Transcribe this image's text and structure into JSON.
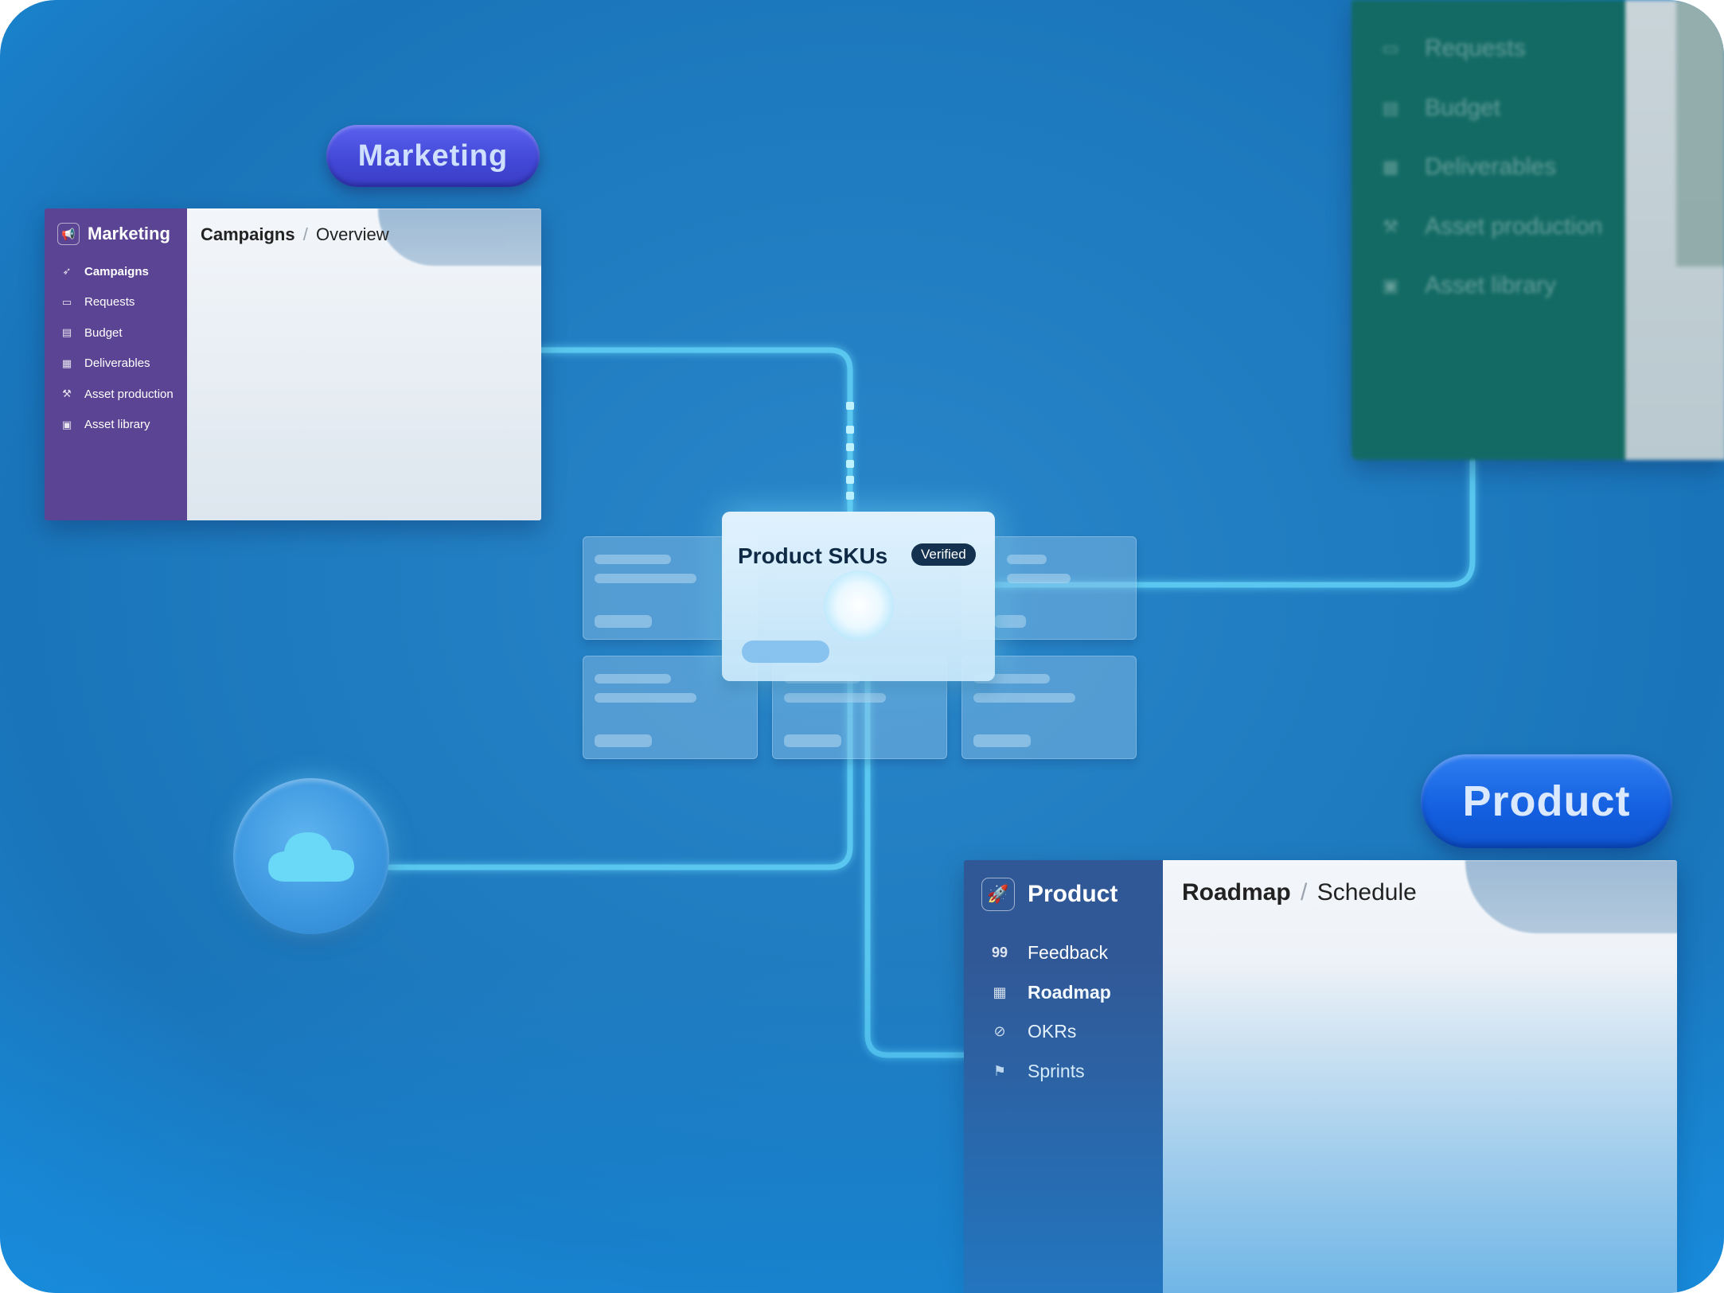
{
  "pills": {
    "marketing": "Marketing",
    "product": "Product"
  },
  "marketing_app": {
    "title": "Marketing",
    "icon": "megaphone-icon",
    "nav": [
      {
        "label": "Campaigns",
        "icon": "rocket-icon",
        "active": true
      },
      {
        "label": "Requests",
        "icon": "inbox-icon",
        "active": false
      },
      {
        "label": "Budget",
        "icon": "calculator-icon",
        "active": false
      },
      {
        "label": "Deliverables",
        "icon": "calendar-icon",
        "active": false
      },
      {
        "label": "Asset production",
        "icon": "tools-icon",
        "active": false
      },
      {
        "label": "Asset library",
        "icon": "image-icon",
        "active": false
      }
    ],
    "breadcrumb": {
      "current": "Campaigns",
      "separator": "/",
      "sub": "Overview"
    },
    "sidebar_color": "#5b4493"
  },
  "product_app": {
    "title": "Product",
    "icon": "rocket-icon",
    "nav": [
      {
        "label": "Feedback",
        "icon": "quote-icon",
        "active": false
      },
      {
        "label": "Roadmap",
        "icon": "calendar-icon",
        "active": true
      },
      {
        "label": "OKRs",
        "icon": "compass-icon",
        "active": false
      },
      {
        "label": "Sprints",
        "icon": "flag-icon",
        "active": false
      }
    ],
    "breadcrumb": {
      "current": "Roadmap",
      "separator": "/",
      "sub": "Schedule"
    },
    "sidebar_color": "#315896"
  },
  "green_app": {
    "nav": [
      {
        "label": "Requests",
        "icon": "inbox-icon"
      },
      {
        "label": "Budget",
        "icon": "calculator-icon"
      },
      {
        "label": "Deliverables",
        "icon": "calendar-icon"
      },
      {
        "label": "Asset production",
        "icon": "tools-icon"
      },
      {
        "label": "Asset library",
        "icon": "image-icon"
      }
    ],
    "sidebar_color": "#136a64"
  },
  "data_card": {
    "title": "Product SKUs",
    "badge": "Verified"
  },
  "cloud": {
    "icon": "cloud-icon"
  },
  "colors": {
    "background": "#1f7bbf",
    "connector": "#5fd0f5",
    "marketing_pill": "#4a4fe0",
    "product_pill": "#1a63e6"
  }
}
